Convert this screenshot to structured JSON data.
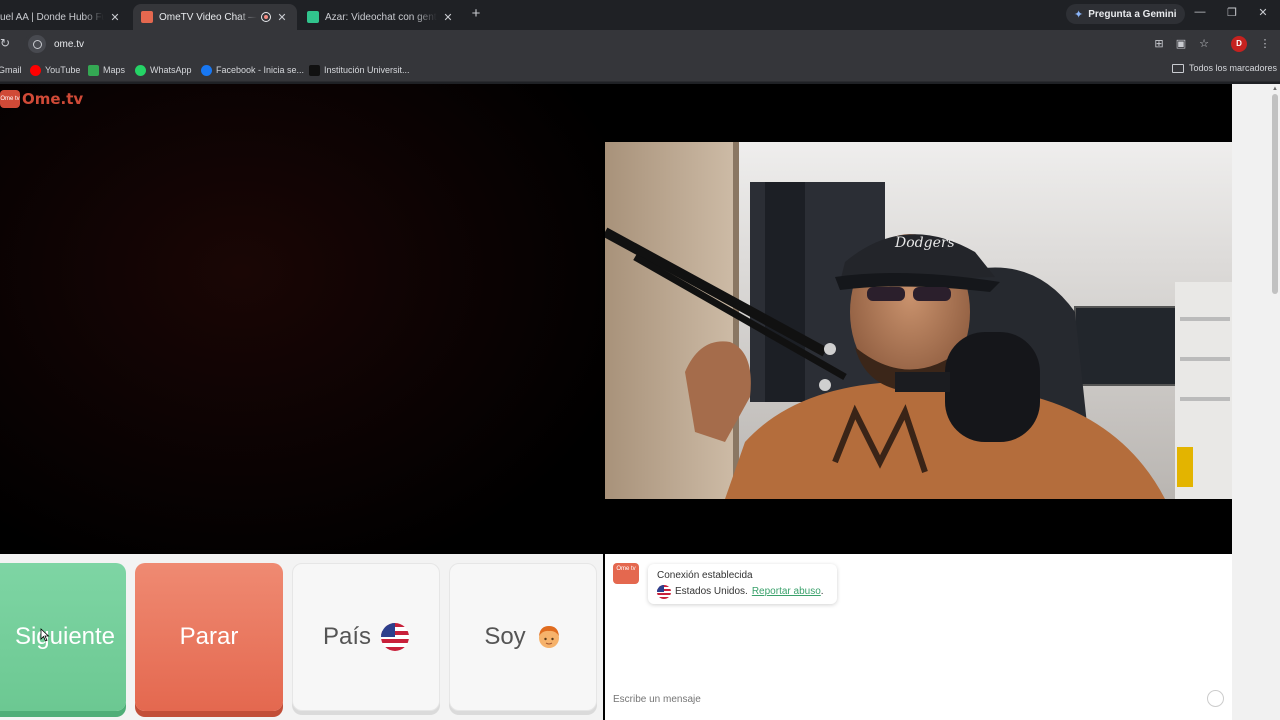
{
  "browser": {
    "tabs": [
      {
        "title": "uel AA | Donde Hubo Fuego",
        "active": false,
        "favicon_color": "#d04a37"
      },
      {
        "title": "OmeTV Video Chat — Ome",
        "active": true,
        "favicon_color": "#e4684f"
      },
      {
        "title": "Azar: Videochat con gente nue",
        "active": false,
        "favicon_color": "#31c48d"
      }
    ],
    "gemini_label": "Pregunta a Gemini",
    "url": "ome.tv",
    "bookmarks": [
      {
        "label": "Gmail",
        "icon": "gmail-icon"
      },
      {
        "label": "YouTube",
        "icon": "youtube-icon"
      },
      {
        "label": "Maps",
        "icon": "maps-icon"
      },
      {
        "label": "WhatsApp",
        "icon": "whatsapp-icon"
      },
      {
        "label": "Facebook - Inicia se...",
        "icon": "facebook-icon"
      },
      {
        "label": "Institución Universit...",
        "icon": "institution-icon"
      }
    ],
    "all_bookmarks_label": "Todos los marcadores",
    "profile_initial": "D"
  },
  "site": {
    "logo_text": "Ome.tv",
    "logo_badge": "Ome tv"
  },
  "controls": {
    "next_label": "Siguiente",
    "stop_label": "Parar",
    "country_label": "País",
    "gender_label": "Soy"
  },
  "chat": {
    "status": "Conexión establecida",
    "country": "Estados Unidos.",
    "report_link": "Reportar abuso",
    "report_suffix": ".",
    "input_placeholder": "Escribe un mensaje"
  },
  "colors": {
    "next": "#6cc892",
    "stop": "#e4684f",
    "link": "#3aa16b"
  }
}
